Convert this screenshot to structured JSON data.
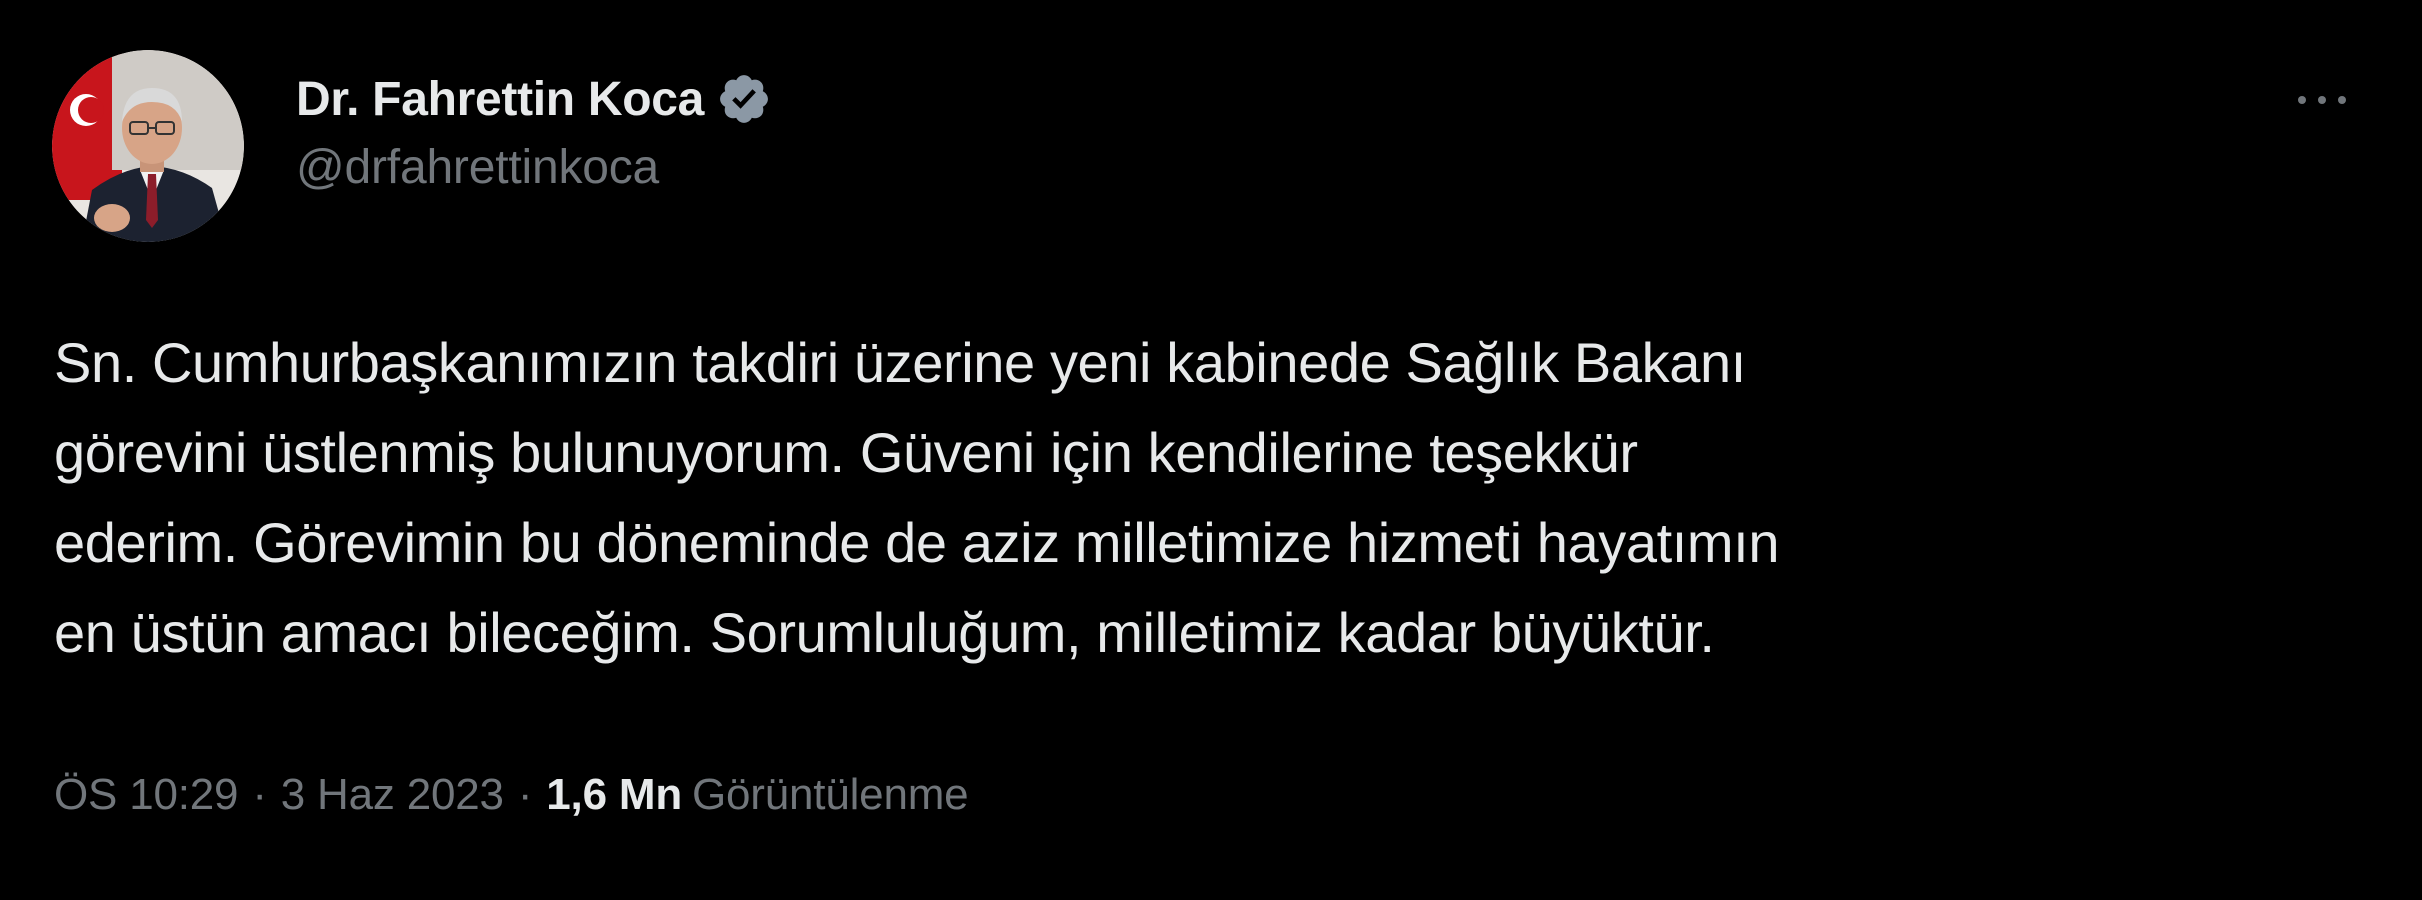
{
  "author": {
    "display_name": "Dr. Fahrettin Koca",
    "handle": "@drfahrettinkoca",
    "verified_icon": "verified-badge-icon",
    "avatar": "profile-photo"
  },
  "tweet": {
    "lines": [
      "Sn. Cumhurbaşkanımızın takdiri üzerine yeni kabinede Sağlık Bakanı",
      "görevini üstlenmiş bulunuyorum. Güveni için kendilerine teşekkür",
      "ederim. Görevimin bu döneminde de aziz milletimize hizmeti hayatımın",
      "en üstün amacı bileceğim. Sorumluluğum, milletimiz kadar büyüktür."
    ]
  },
  "meta": {
    "time": "ÖS 10:29",
    "separator": "·",
    "date": "3 Haz 2023",
    "views_count": "1,6 Mn",
    "views_label": "Görüntülenme"
  },
  "actions": {
    "more_icon": "more-dots-icon"
  },
  "colors": {
    "background": "#000000",
    "primary_text": "#e7e9ea",
    "secondary_text": "#71767b",
    "verified_badge": "#8b98a5"
  }
}
